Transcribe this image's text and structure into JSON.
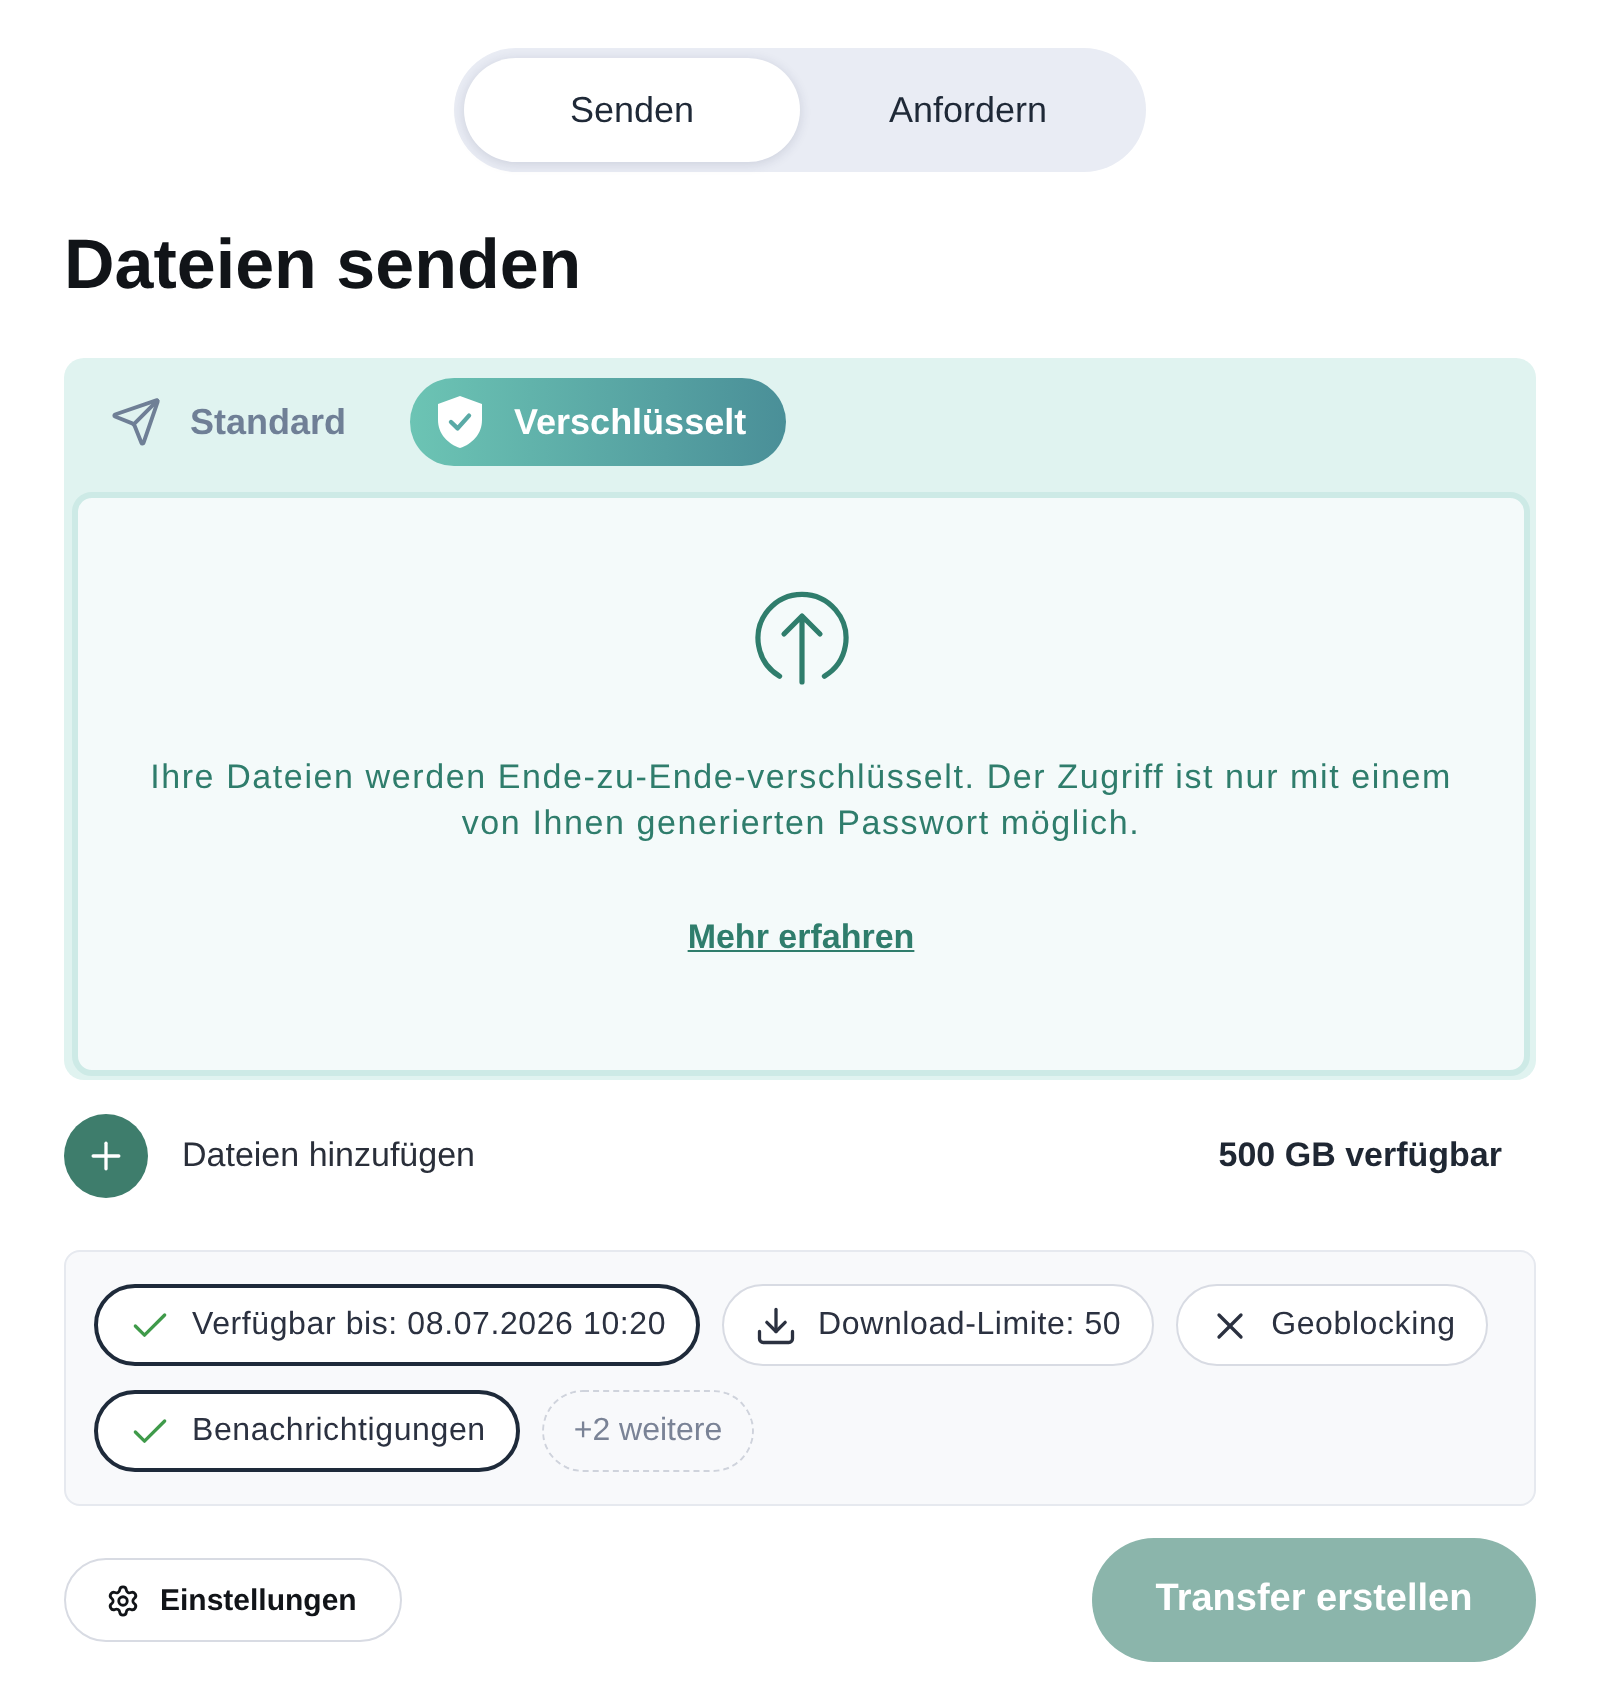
{
  "mode_toggle": [
    {
      "label": "Senden",
      "selected": true
    },
    {
      "label": "Anfordern",
      "selected": false
    }
  ],
  "title": "Dateien senden",
  "transfer_type_tabs": [
    {
      "kind": "standard",
      "label": "Standard",
      "selected": false
    },
    {
      "kind": "encrypted",
      "label": "Verschlüsselt",
      "selected": true
    }
  ],
  "info_panel": {
    "text": "Ihre Dateien werden Ende-zu-Ende-verschlüsselt. Der Zugriff ist nur mit einem von Ihnen generierten Passwort möglich.",
    "link": "Mehr erfahren"
  },
  "add_files": {
    "label": "Dateien hinzufügen"
  },
  "storage": "500 GB verfügbar",
  "options": [
    {
      "kind": "check",
      "label": "Verfügbar bis: 08.07.2026 10:20",
      "active": true
    },
    {
      "kind": "download",
      "label": "Download-Limite: 50",
      "active": false
    },
    {
      "kind": "cross",
      "label": "Geoblocking",
      "active": false
    },
    {
      "kind": "check",
      "label": "Benachrichtigungen",
      "active": true
    }
  ],
  "more_options": "+2 weitere",
  "settings_button": "Einstellungen",
  "submit_button": {
    "label": "Transfer erstellen",
    "disabled": true
  }
}
